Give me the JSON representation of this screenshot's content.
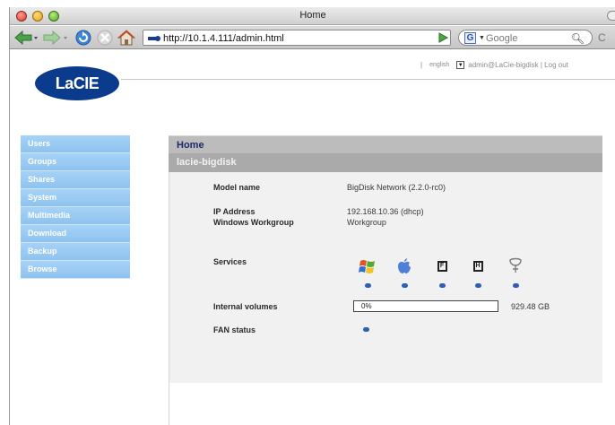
{
  "window": {
    "title": "Home"
  },
  "toolbar": {
    "url": "http://10.1.4.111/admin.html",
    "search_placeholder": "Google"
  },
  "header": {
    "logo_text": "LaCIE",
    "separator": "|",
    "language": "english",
    "user_links": "admin@LaCie-bigdisk | Log out"
  },
  "sidebar": {
    "items": [
      {
        "label": "Users"
      },
      {
        "label": "Groups"
      },
      {
        "label": "Shares"
      },
      {
        "label": "System"
      },
      {
        "label": "Multimedia"
      },
      {
        "label": "Download"
      },
      {
        "label": "Backup"
      },
      {
        "label": "Browse"
      }
    ]
  },
  "main": {
    "title": "Home",
    "device_name": "lacie-bigdisk",
    "model_label": "Model name",
    "model_value": "BigDisk Network (2.2.0-rc0)",
    "ip_label": "IP Address",
    "ip_value": "192.168.10.36 (dhcp)",
    "workgroup_label": "Windows Workgroup",
    "workgroup_value": "Workgroup",
    "services_label": "Services",
    "services": [
      {
        "icon": "windows-icon",
        "status": "on"
      },
      {
        "icon": "apple-icon",
        "status": "on"
      },
      {
        "icon": "ftp-icon",
        "glyph": "F",
        "status": "on"
      },
      {
        "icon": "http-icon",
        "glyph": "H",
        "status": "on"
      },
      {
        "icon": "upnp-icon",
        "status": "on"
      }
    ],
    "volumes_label": "Internal volumes",
    "volume_percent": "0%",
    "volume_size": "929.48 GB",
    "fan_label": "FAN status"
  },
  "colors": {
    "sidebar": "#9ccbf3",
    "logo": "#0a3b8c",
    "status_dot": "#2f5fb3",
    "title_bar": "#bcbcbc"
  }
}
